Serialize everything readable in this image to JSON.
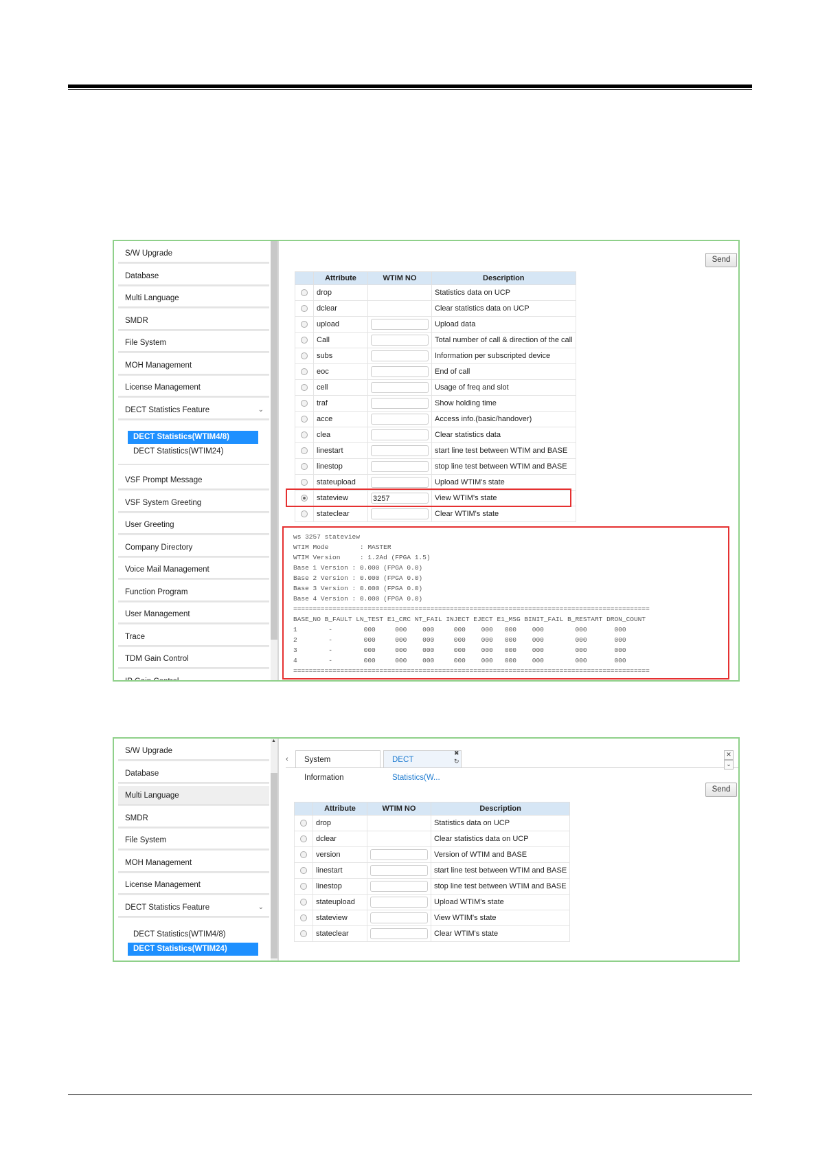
{
  "screen1": {
    "sidebar": [
      "S/W Upgrade",
      "Database",
      "Multi Language",
      "SMDR",
      "File System",
      "MOH Management",
      "License Management",
      "DECT Statistics Feature"
    ],
    "submenu": [
      "DECT Statistics(WTIM4/8)",
      "DECT Statistics(WTIM24)"
    ],
    "sidebar_after": [
      "VSF Prompt Message",
      "VSF System Greeting",
      "User Greeting",
      "Company Directory",
      "Voice Mail Management",
      "Function Program",
      "User Management",
      "Trace",
      "TDM Gain Control",
      "IP Gain Control"
    ],
    "send_label": "Send",
    "table_headers": [
      "Attribute",
      "WTIM NO",
      "Description"
    ],
    "rows": [
      {
        "attr": "drop",
        "has_input": false,
        "value": "",
        "desc": "Statistics data on UCP"
      },
      {
        "attr": "dclear",
        "has_input": false,
        "value": "",
        "desc": "Clear statistics data on UCP"
      },
      {
        "attr": "upload",
        "has_input": true,
        "value": "",
        "desc": "Upload data"
      },
      {
        "attr": "Call",
        "has_input": true,
        "value": "",
        "desc": "Total number of call & direction of the call"
      },
      {
        "attr": "subs",
        "has_input": true,
        "value": "",
        "desc": "Information per subscripted device"
      },
      {
        "attr": "eoc",
        "has_input": true,
        "value": "",
        "desc": "End of call"
      },
      {
        "attr": "cell",
        "has_input": true,
        "value": "",
        "desc": "Usage of freq and slot"
      },
      {
        "attr": "traf",
        "has_input": true,
        "value": "",
        "desc": "Show holding time"
      },
      {
        "attr": "acce",
        "has_input": true,
        "value": "",
        "desc": "Access info.(basic/handover)"
      },
      {
        "attr": "clea",
        "has_input": true,
        "value": "",
        "desc": "Clear statistics data"
      },
      {
        "attr": "linestart",
        "has_input": true,
        "value": "",
        "desc": "start line test between WTIM and BASE"
      },
      {
        "attr": "linestop",
        "has_input": true,
        "value": "",
        "desc": "stop line test between WTIM and BASE"
      },
      {
        "attr": "stateupload",
        "has_input": true,
        "value": "",
        "desc": "Upload WTIM's state"
      },
      {
        "attr": "stateview",
        "has_input": true,
        "value": "3257",
        "desc": "View WTIM's state",
        "selected": true
      },
      {
        "attr": "stateclear",
        "has_input": true,
        "value": "",
        "desc": "Clear WTIM's state"
      }
    ],
    "console_lines": [
      "ws 3257 stateview",
      "WTIM Mode        : MASTER",
      "WTIM Version     : 1.2Ad (FPGA 1.5)",
      "Base 1 Version : 0.000 (FPGA 0.0)",
      "Base 2 Version : 0.000 (FPGA 0.0)",
      "Base 3 Version : 0.000 (FPGA 0.0)",
      "Base 4 Version : 0.000 (FPGA 0.0)",
      "===========================================================================================",
      "BASE_NO B_FAULT LN_TEST E1_CRC NT_FAIL INJECT EJECT E1_MSG BINIT_FAIL B_RESTART DRON_COUNT",
      "1        -        000     000    000     000    000   000    000        000       000",
      "2        -        000     000    000     000    000   000    000        000       000",
      "3        -        000     000    000     000    000   000    000        000       000",
      "4        -        000     000    000     000    000   000    000        000       000",
      "==========================================================================================="
    ]
  },
  "screen2": {
    "sidebar": [
      "S/W Upgrade",
      "Database",
      "Multi Language",
      "SMDR",
      "File System",
      "MOH Management",
      "License Management",
      "DECT Statistics Feature"
    ],
    "submenu": [
      "DECT Statistics(WTIM4/8)",
      "DECT Statistics(WTIM24)"
    ],
    "tabs": [
      "System Information",
      "DECT Statistics(W..."
    ],
    "send_label": "Send",
    "table_headers": [
      "Attribute",
      "WTIM NO",
      "Description"
    ],
    "rows": [
      {
        "attr": "drop",
        "has_input": false,
        "desc": "Statistics data on UCP"
      },
      {
        "attr": "dclear",
        "has_input": false,
        "desc": "Clear statistics data on UCP"
      },
      {
        "attr": "version",
        "has_input": true,
        "desc": "Version of WTIM and BASE"
      },
      {
        "attr": "linestart",
        "has_input": true,
        "desc": "start line test between WTIM and BASE"
      },
      {
        "attr": "linestop",
        "has_input": true,
        "desc": "stop line test between WTIM and BASE"
      },
      {
        "attr": "stateupload",
        "has_input": true,
        "desc": "Upload WTIM's state"
      },
      {
        "attr": "stateview",
        "has_input": true,
        "desc": "View WTIM's state"
      },
      {
        "attr": "stateclear",
        "has_input": true,
        "desc": "Clear WTIM's state"
      }
    ]
  }
}
